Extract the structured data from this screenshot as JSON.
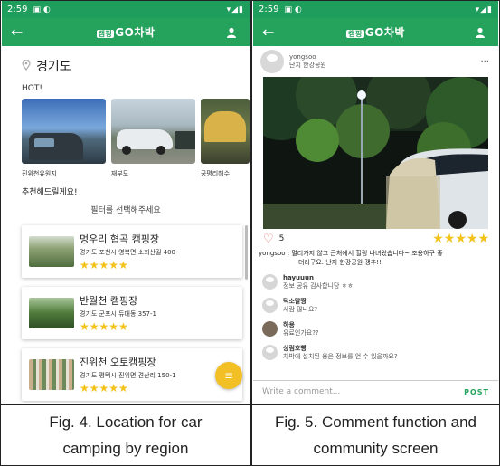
{
  "colors": {
    "brand_green": "#25a35d",
    "star_yellow": "#f3c21b",
    "fab_yellow": "#f2c024",
    "heart": "#e06c6c"
  },
  "left_screen": {
    "status": {
      "time": "2:59",
      "icons": "▣ ◐",
      "right": "▾◢▮"
    },
    "appbar": {
      "back_icon": "←",
      "logo_badge": "캠핑",
      "title": "GO차박"
    },
    "region": {
      "name": "경기도"
    },
    "hot_label": "HOT!",
    "hot_places": [
      {
        "caption": "진위천유원지"
      },
      {
        "caption": "재부도"
      },
      {
        "caption": "궁평리해수"
      }
    ],
    "recommend_label": "추천해드릴게요!",
    "filter_label": "필터를 선택해주세요",
    "campgrounds": [
      {
        "name": "멍우리 협곡 캠핑장",
        "address": "경기도 포천시 영북면 소회산길 400",
        "rating": 5,
        "stars": "★★★★★"
      },
      {
        "name": "반월천 캠핑장",
        "address": "경기도 군포시 듀대동 357-1",
        "rating": 5,
        "stars": "★★★★★"
      },
      {
        "name": "진위천 오토캠핑장",
        "address": "경기도 평택시 진위면 견산리 150-1",
        "rating": 5,
        "stars": "★★★★★"
      }
    ],
    "fab_icon": "≡"
  },
  "right_screen": {
    "status": {
      "time": "2:59",
      "icons": "▣ ◐",
      "right": "▾◢▮"
    },
    "appbar": {
      "back_icon": "←",
      "logo_badge": "캠핑",
      "title": "GO차박"
    },
    "post": {
      "user": "yongsoo",
      "place": "난지 한강공원",
      "more_icon": "···",
      "likes": "5",
      "rating": 5,
      "stars": "★★★★★",
      "caption_line1": "yongsoo : 멀리가지 않고 근처에서 힐링 나녀왔습니다~ 조용하구 좋",
      "caption_line2": "더라구요. 난지 한강공원 갱추!!"
    },
    "comments": [
      {
        "user": "hayuuun",
        "text": "정보 공유 감사합니당 ㅎㅎ"
      },
      {
        "user": "덕소말짱",
        "text": "사람 많나요?"
      },
      {
        "user": "하용",
        "text": "유료인가요??"
      },
      {
        "user": "상림호빵",
        "text": "차박에 설치된 용은 정보를 얻 수 있을까요?"
      }
    ],
    "comment_input": {
      "placeholder": "Write a comment...",
      "post_label": "POST"
    }
  },
  "figure_captions": {
    "left": {
      "line1": "Fig. 4. Location for car",
      "line2": "camping by region"
    },
    "right": {
      "line1": "Fig. 5. Comment function and",
      "line2": "community screen"
    }
  }
}
